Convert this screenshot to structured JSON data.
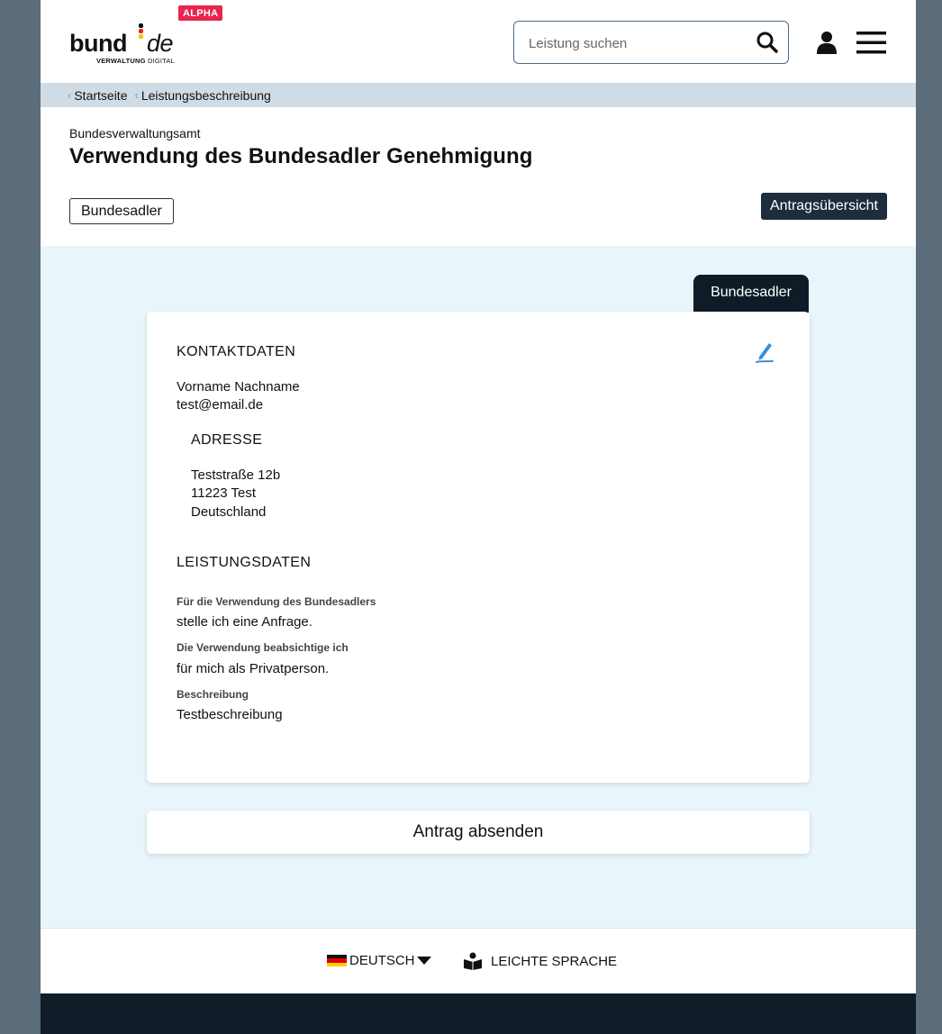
{
  "header": {
    "badge": "ALPHA",
    "logo_bund": "bund",
    "logo_de": "de",
    "logo_sub_bold": "VERWALTUNG",
    "logo_sub_light": "DIGITAL",
    "search_placeholder": "Leistung suchen"
  },
  "breadcrumb": {
    "items": [
      {
        "label": "Startseite"
      },
      {
        "label": "Leistungsbeschreibung"
      }
    ]
  },
  "title_area": {
    "authority": "Bundesverwaltungsamt",
    "title": "Verwendung des Bundesadler Genehmigung",
    "tag_button": "Bundesadler",
    "overview_button": "Antragsübersicht"
  },
  "main": {
    "folder_tab": "Bundesadler",
    "contact": {
      "heading": "KONTAKTDATEN",
      "name": "Vorname Nachname",
      "email": "test@email.de",
      "address_heading": "ADRESSE",
      "street": "Teststraße 12b",
      "city": "11223 Test",
      "country": "Deutschland"
    },
    "service": {
      "heading": "LEISTUNGSDATEN",
      "fields": [
        {
          "label": "Für die Verwendung des Bundesadlers",
          "value": "stelle ich eine Anfrage."
        },
        {
          "label": "Die Verwendung beabsichtige ich",
          "value": "für mich als Privatperson."
        },
        {
          "label": "Beschreibung",
          "value": "Testbeschreibung"
        }
      ]
    },
    "submit_button": "Antrag absenden"
  },
  "footer": {
    "language": "DEUTSCH",
    "easy_language": "LEICHTE SPRACHE"
  },
  "colors": {
    "outer_background": "#5b6c7b",
    "breadcrumb_bg": "#cfdce6",
    "main_bg": "#e8f6fb",
    "dark_navy": "#0f1c28",
    "button_navy": "#1e2d3d",
    "alpha_red": "#e8244f",
    "edit_icon_blue": "#3a8fd6"
  },
  "icons": [
    "search-icon",
    "user-icon",
    "menu-icon",
    "edit-icon",
    "flag-de-icon",
    "caret-down-icon",
    "easy-language-icon"
  ]
}
